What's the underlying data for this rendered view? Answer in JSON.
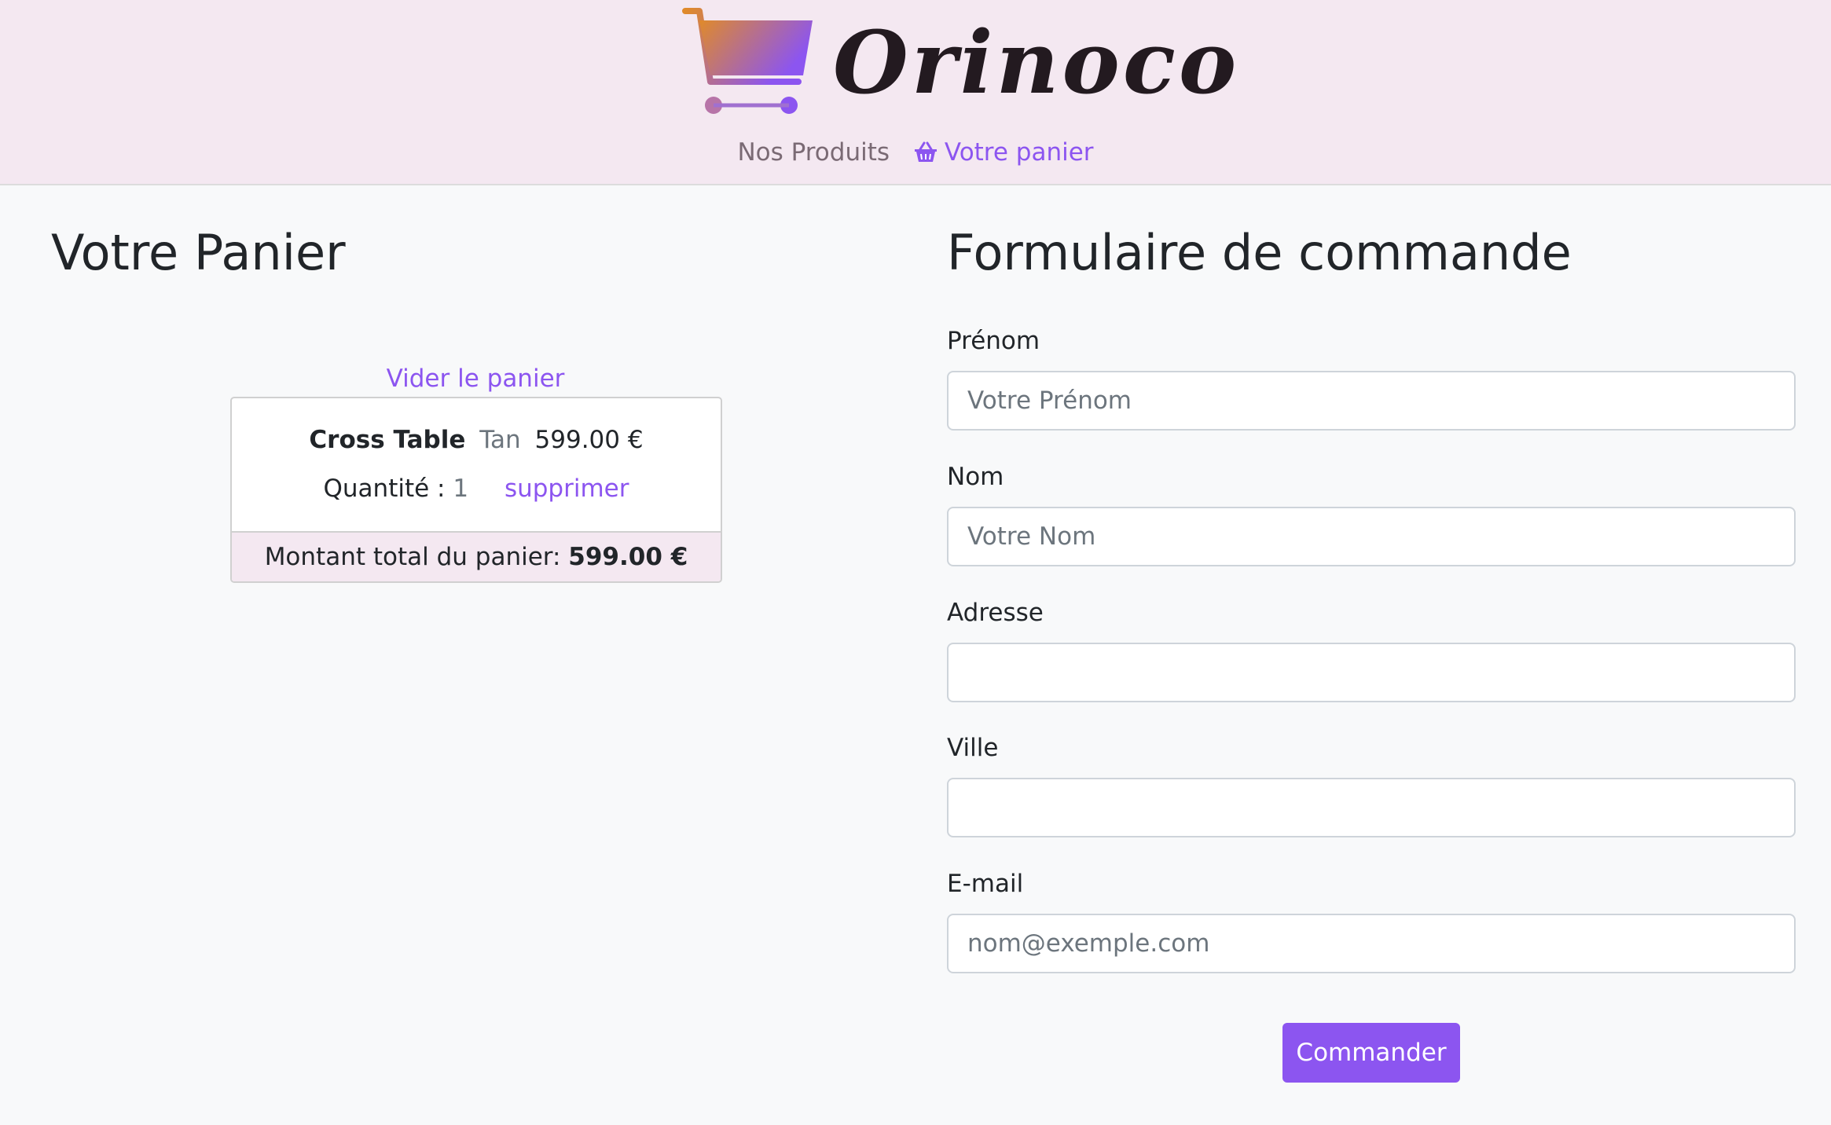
{
  "header": {
    "brand": "Orinoco",
    "nav": {
      "products": "Nos Produits",
      "cart": "Votre panier"
    }
  },
  "cart": {
    "title": "Votre Panier",
    "empty_link": "Vider le panier",
    "items": [
      {
        "name": "Cross Table",
        "color": "Tan",
        "price": "599.00 €",
        "quantity_label": "Quantité :",
        "quantity": "1",
        "remove_label": "supprimer"
      }
    ],
    "total_label": "Montant total du panier:",
    "total_value": "599.00 €"
  },
  "form": {
    "title": "Formulaire de commande",
    "fields": [
      {
        "label": "Prénom",
        "placeholder": "Votre Prénom",
        "value": ""
      },
      {
        "label": "Nom",
        "placeholder": "Votre Nom",
        "value": ""
      },
      {
        "label": "Adresse",
        "placeholder": "",
        "value": ""
      },
      {
        "label": "Ville",
        "placeholder": "",
        "value": ""
      },
      {
        "label": "E-mail",
        "placeholder": "nom@exemple.com",
        "value": ""
      }
    ],
    "submit_label": "Commander"
  },
  "colors": {
    "accent": "#8c55f0",
    "header_bg": "#f4e8f1",
    "page_bg": "#f8f9fa",
    "logo_gradient_start": "#e08a2a",
    "logo_gradient_end": "#8c55f0"
  },
  "icons": {
    "logo": "shopping-cart-icon",
    "nav_cart": "basket-icon"
  }
}
